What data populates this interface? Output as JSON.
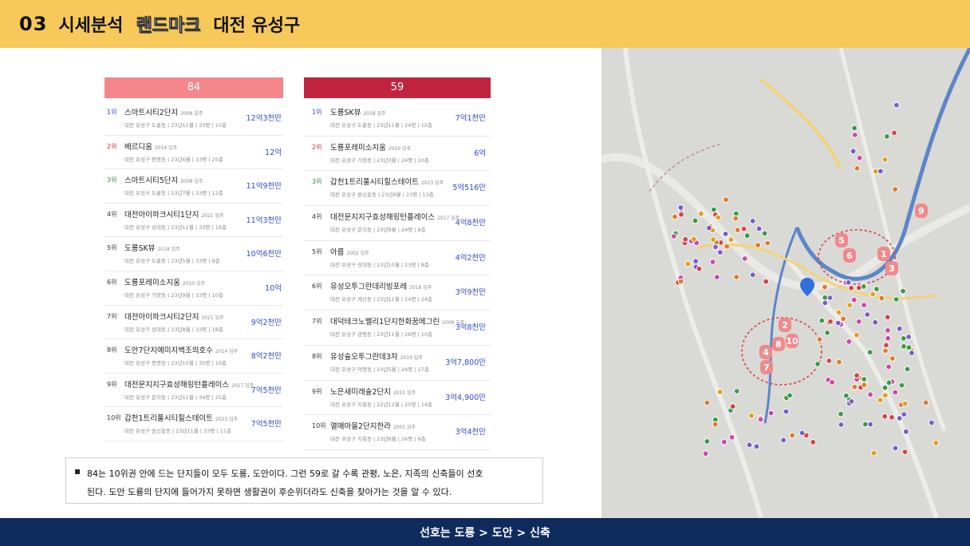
{
  "header": {
    "number": "03",
    "title": "시세분석",
    "highlight": "랜드마크",
    "region": "대전 유성구"
  },
  "left": {
    "title": "84",
    "items": [
      {
        "rank": "1위",
        "name": "스마트시티2단지",
        "year": "2008 입주",
        "detail": "대전 유성구 도룡동 | 23년11월 | 33평 | 10층",
        "price": "12억3천만"
      },
      {
        "rank": "2위",
        "name": "베르디움",
        "year": "2014 입주",
        "detail": "대전 유성구 봉명동 | 23년6월 | 33평 | 25층",
        "price": "12억"
      },
      {
        "rank": "3위",
        "name": "스마트시티5단지",
        "year": "2008 입주",
        "detail": "대전 유성구 도룡동 | 23년7월 | 33평 | 12층",
        "price": "11억9천만"
      },
      {
        "rank": "4위",
        "name": "대전아이파크시티1단지",
        "year": "2021 입주",
        "detail": "대전 유성구 상대동 | 23년12월 | 33평 | 18층",
        "price": "11억3천만"
      },
      {
        "rank": "5위",
        "name": "도룡SK뷰",
        "year": "2018 입주",
        "detail": "대전 유성구 도룡동 | 23년5월 | 33평 | 9층",
        "price": "10억6천만"
      },
      {
        "rank": "6위",
        "name": "도룡포레미소지움",
        "year": "2020 입주",
        "detail": "대전 유성구 가정동 | 23년9월 | 33평 | 10층",
        "price": "10억"
      },
      {
        "rank": "7위",
        "name": "대전아이파크시티2단지",
        "year": "2021 입주",
        "detail": "대전 유성구 상대동 | 23년8월 | 33평 | 18층",
        "price": "9억2천만"
      },
      {
        "rank": "8위",
        "name": "도안7단지예미지백조의호수",
        "year": "2014 입주",
        "detail": "대전 유성구 봉명동 | 23년10월 | 35평 | 10층",
        "price": "8억2천만"
      },
      {
        "rank": "9위",
        "name": "대전문지지구효성해링턴플레이스",
        "year": "2017 입주",
        "detail": "대전 유성구 문지동 | 23년11월 | 34평 | 25층",
        "price": "7억5천만"
      },
      {
        "rank": "10위",
        "name": "갑천1트리풀시티힐스테이트",
        "year": "2023 입주",
        "detail": "대전 유성구 원신흥동 | 23년11월 | 33평 | 11층",
        "price": "7억5천만"
      }
    ]
  },
  "right": {
    "title": "59",
    "items": [
      {
        "rank": "1위",
        "name": "도룡SK뷰",
        "year": "2018 입주",
        "detail": "대전 유성구 도룡동 | 23년11월 | 24평 | 12층",
        "price": "7억1천만"
      },
      {
        "rank": "2위",
        "name": "도룡포레미소지움",
        "year": "2020 입주",
        "detail": "대전 유성구 가정동 | 23년3월 | 24평 | 10층",
        "price": "6억"
      },
      {
        "rank": "3위",
        "name": "갑천1트리풀시티힐스테이트",
        "year": "2023 입주",
        "detail": "대전 유성구 원신흥동 | 23년8월 | 23평 | 13층",
        "price": "5억516만"
      },
      {
        "rank": "4위",
        "name": "대전문지지구효성해링턴플레이스",
        "year": "2017 입주",
        "detail": "대전 유성구 문지동 | 23년9월 | 24평 | 8층",
        "price": "4억8천만"
      },
      {
        "rank": "5위",
        "name": "아름",
        "year": "2002 입주",
        "detail": "대전 유성구 장대동 | 23년10월 | 23평 | 8층",
        "price": "4억2천만"
      },
      {
        "rank": "6위",
        "name": "유성오투그란데리빙포레",
        "year": "2018 입주",
        "detail": "대전 유성구 계산동 | 23년11월 | 24평 | 24층",
        "price": "3억9천만"
      },
      {
        "rank": "7위",
        "name": "대덕테크노밸리1단지한화꿈에그린",
        "year": "2006 입주",
        "detail": "대전 유성구 관평동 | 23년11월 | 26평 | 10층",
        "price": "3억8천만"
      },
      {
        "rank": "8위",
        "name": "유성숲오투그란데3차",
        "year": "2019 입주",
        "detail": "대전 유성구 덕명동 | 23년5월 | 24평 | 27층",
        "price": "3억7,800만"
      },
      {
        "rank": "9위",
        "name": "노은새미래숲2단지",
        "year": "2015 입주",
        "detail": "대전 유성구 지족동 | 22년12월 | 25평 | 14층",
        "price": "3억4,900만"
      },
      {
        "rank": "10위",
        "name": "열매마을2단지한라",
        "year": "2001 입주",
        "detail": "대전 유성구 지족동 | 23년8월 | 26평 | 9층",
        "price": "3억4천만"
      }
    ]
  },
  "note": {
    "bullet": "▪",
    "line1": "84는 10위권 안에 드는 단지들이 모두 도룡, 도안이다. 그런 59로 갈 수록 관평, 노은, 지족의 신축들이 선호",
    "line2": "된다. 도안 도룡의 단지에 들어가지 못하면 생활권이 후순위더라도 신축을 찾아가는 것을 알 수 있다."
  },
  "map": {
    "markers": [
      "1",
      "2",
      "3",
      "4",
      "5",
      "6",
      "7",
      "8",
      "9",
      "10"
    ],
    "colors": {
      "marker": "#f08a8a",
      "highlight": "#d84040",
      "water": "#5577cc"
    }
  },
  "footer": {
    "text": "선호는 도룡 > 도안 > 신축"
  }
}
